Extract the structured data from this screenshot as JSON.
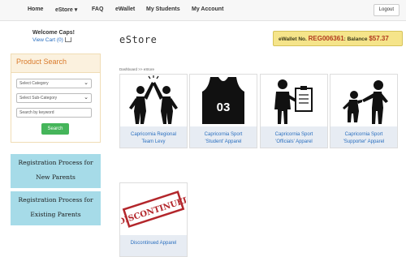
{
  "nav": {
    "items": [
      "Home",
      "eStore ▾",
      "FAQ",
      "eWallet",
      "My Students",
      "My Account"
    ],
    "logout": "Logout"
  },
  "welcome": {
    "greeting": "Welcome Caps!",
    "cart": "View Cart (0)"
  },
  "store": {
    "title": "eStore",
    "breadcrumb": "Dashboard >> eStore"
  },
  "wallet": {
    "label": "eWallet No.",
    "number": "REG006361",
    "balance_label": ": Balance",
    "balance": "$57.37"
  },
  "search_panel": {
    "title": "Product Search",
    "category": "Select Category",
    "subcategory": "Select Sub-Category",
    "keyword_placeholder": "Search by keyword",
    "search_button": "Search"
  },
  "registration": [
    {
      "line1": "Registration Process for",
      "line2": "New Parents"
    },
    {
      "line1": "Registration Process for",
      "line2": "Existing  Parents"
    }
  ],
  "products": [
    {
      "line1": "Capricornia Regional",
      "line2": "Team Levy",
      "icon": "high-five-icon"
    },
    {
      "line1": "Capricornia Sport",
      "line2": "'Student' Apparel",
      "icon": "jersey-icon",
      "jersey_number": "03"
    },
    {
      "line1": "Capricornia Sport",
      "line2": "'Officials' Apparel",
      "icon": "official-clipboard-icon"
    },
    {
      "line1": "Capricornia Sport",
      "line2": "'Supporter' Apparel",
      "icon": "supporter-icon"
    },
    {
      "line1": "Discontinued Apparel",
      "line2": "",
      "icon": "discontinued-stamp-icon",
      "stamp": "DISCONTINUED"
    }
  ],
  "colors": {
    "accent": "#2a6fbf",
    "search_green": "#45b55a",
    "wallet_bg": "#f5e48a",
    "reg_bg": "#a6dbe8",
    "panel_title": "#d97a2b"
  }
}
